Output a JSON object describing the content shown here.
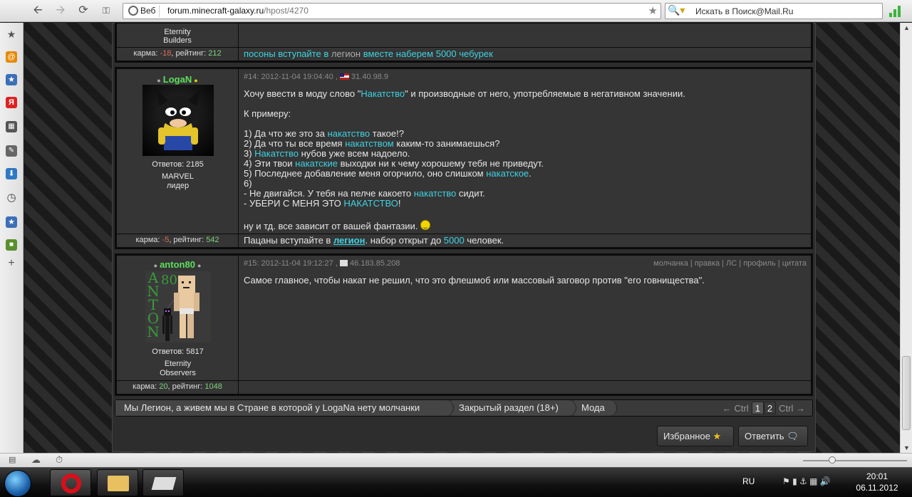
{
  "browser": {
    "address_prefix": "Веб",
    "url_domain": "forum.minecraft-galaxy.ru",
    "url_path": "/hpost/4270",
    "search_placeholder": "Искать в Поиск@Mail.Ru"
  },
  "sidebar": {
    "icons": [
      "star-icon",
      "opera-mail-icon",
      "speeddial-icon",
      "yandex-icon",
      "panels-icon",
      "notes-icon",
      "downloads-icon",
      "history-icon",
      "bookmarks-icon",
      "minecraft-icon",
      "add-icon"
    ]
  },
  "posts": {
    "prev": {
      "clan": "Eternity",
      "role": "Builders",
      "karma_label": "карма: ",
      "karma_value": "-18",
      "rating_label": ", рейтинг: ",
      "rating_value": "212",
      "signature_parts": [
        "посоны вступайте в",
        " легион ",
        "вместе наберем 5000 чебурек"
      ]
    },
    "p14": {
      "username": "LogaN",
      "replies": "Ответов: 2185",
      "clan": "MARVEL",
      "role": "лидер",
      "meta": "#14: 2012-11-04 19:04:40 ,",
      "ip": "31.40.98.9",
      "karma_label": "карма: ",
      "karma_value": "-5",
      "rating_label": ", рейтинг: ",
      "rating_value": "542",
      "signature": {
        "before": "Пацаны вступайте в ",
        "link": "легион",
        "middle": ". набор открыт до ",
        "num": "5000",
        "after": " человек."
      },
      "body": {
        "l1a": "Хочу ввести в моду слово \"",
        "l1b": "Накатство",
        "l1c": "\" и производные от него, употребляемые в негативном значении.",
        "l2": "К примеру:",
        "i1a": "1) Да что же это за ",
        "i1b": "накатство",
        "i1c": " такое!?",
        "i2a": "2) Да что ты все время ",
        "i2b": "накатством",
        "i2c": " каким-то занимаешься?",
        "i3a": "3) ",
        "i3b": "Накатство",
        "i3c": " нубов уже всем надоело.",
        "i4a": "4) Эти твои ",
        "i4b": "накатские",
        "i4c": " выходки ни к чему хорошему тебя не приведут.",
        "i5a": "5) Последнее добавление меня огорчило, оно слишком ",
        "i5b": "накатское",
        "i5c": ".",
        "i6": "6)",
        "i6aa": "- Не двигайся. У тебя на пелче какоето ",
        "i6ab": "накатство",
        "i6ac": " сидит.",
        "i6ba": "- УБЕРИ С МЕНЯ ЭТО ",
        "i6bb": "НАКАТСТВО",
        "i6bc": "!",
        "end": "ну и тд. все зависит от вашей фантазии. "
      }
    },
    "p15": {
      "username": "anton80",
      "replies": "Ответов: 5817",
      "clan": "Eternity",
      "role": "Observers",
      "meta": "#15: 2012-11-04 19:12:27 ,",
      "ip": "46.183.85.208",
      "actions": [
        "молчанка",
        "правка",
        "ЛС",
        "профиль",
        "цитата"
      ],
      "body": "Самое главное, чтобы накат не решил, что это флешмоб или массовый заговор против \"его говнищества\".",
      "karma_label": "карма: ",
      "karma_value": "20",
      "rating_label": ", рейтинг: ",
      "rating_value": "1048",
      "avatar_text": [
        "A",
        "N",
        "T",
        "O",
        "N",
        "80"
      ]
    }
  },
  "breadcrumbs": [
    "Мы Легион, а живем мы в Стране в которой у LogaNa нету молчанки",
    "Закрытый раздел (18+)",
    "Мода"
  ],
  "pager": {
    "prev": "← Ctrl",
    "pages": [
      "1",
      "2"
    ],
    "next": "Ctrl →"
  },
  "buttons": {
    "favorites": "Избранное",
    "reply": "Ответить"
  },
  "taskbar": {
    "lang": "RU",
    "time": "20:01",
    "date": "06.11.2012"
  },
  "colors": {
    "highlight": "#3fd1e0",
    "username": "#5ce05c",
    "negative": "#e06a5a",
    "positive": "#7fd27f"
  }
}
